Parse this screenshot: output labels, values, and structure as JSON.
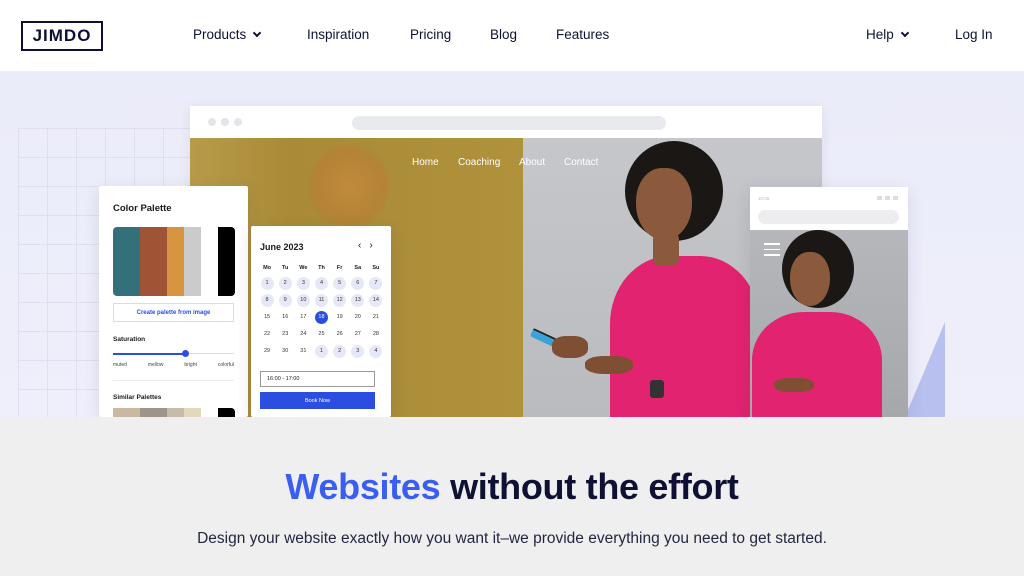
{
  "nav": {
    "logo": "JIMDO",
    "items": [
      {
        "label": "Products",
        "has_dropdown": true
      },
      {
        "label": "Inspiration",
        "has_dropdown": false
      },
      {
        "label": "Pricing",
        "has_dropdown": false
      },
      {
        "label": "Blog",
        "has_dropdown": false
      },
      {
        "label": "Features",
        "has_dropdown": false
      }
    ],
    "help": {
      "label": "Help",
      "has_dropdown": true
    },
    "login": "Log In"
  },
  "hero": {
    "browser_site_nav": [
      "Home",
      "Coaching",
      "About",
      "Contact"
    ],
    "palette_card": {
      "title": "Color Palette",
      "swatches": [
        "#33707a",
        "#a05436",
        "#d89540",
        "#cbcbcb",
        "#ffffff",
        "#000000"
      ],
      "button": "Create palette from image",
      "saturation_label": "Saturation",
      "saturation_options": [
        "muted",
        "mellow",
        "bright",
        "colorful"
      ],
      "saturation_value": 0.6,
      "similar_title": "Similar Palettes",
      "similar_swatches": [
        "#c9b9a0",
        "#9d958c",
        "#c7bca9",
        "#e3d7bd",
        "#ffffff",
        "#000000"
      ]
    },
    "calendar_card": {
      "month": "June 2023",
      "prev_icon": "chevron-left-icon",
      "next_icon": "chevron-right-icon",
      "weekdays": [
        "Mo",
        "Tu",
        "We",
        "Th",
        "Fr",
        "Sa",
        "Su"
      ],
      "days": [
        {
          "d": "1",
          "s": "avail"
        },
        {
          "d": "2",
          "s": "avail"
        },
        {
          "d": "3",
          "s": "avail"
        },
        {
          "d": "4",
          "s": "avail"
        },
        {
          "d": "5",
          "s": "avail"
        },
        {
          "d": "6",
          "s": "avail"
        },
        {
          "d": "7",
          "s": "avail"
        },
        {
          "d": "8",
          "s": "avail"
        },
        {
          "d": "9",
          "s": "avail"
        },
        {
          "d": "10",
          "s": "avail"
        },
        {
          "d": "11",
          "s": "avail"
        },
        {
          "d": "12",
          "s": "avail"
        },
        {
          "d": "13",
          "s": "avail"
        },
        {
          "d": "14",
          "s": "avail"
        },
        {
          "d": "15",
          "s": ""
        },
        {
          "d": "16",
          "s": ""
        },
        {
          "d": "17",
          "s": ""
        },
        {
          "d": "18",
          "s": "sel"
        },
        {
          "d": "19",
          "s": ""
        },
        {
          "d": "20",
          "s": ""
        },
        {
          "d": "21",
          "s": ""
        },
        {
          "d": "22",
          "s": ""
        },
        {
          "d": "23",
          "s": ""
        },
        {
          "d": "24",
          "s": ""
        },
        {
          "d": "25",
          "s": ""
        },
        {
          "d": "26",
          "s": ""
        },
        {
          "d": "27",
          "s": ""
        },
        {
          "d": "28",
          "s": ""
        },
        {
          "d": "29",
          "s": ""
        },
        {
          "d": "30",
          "s": ""
        },
        {
          "d": "31",
          "s": ""
        },
        {
          "d": "1",
          "s": "avail"
        },
        {
          "d": "2",
          "s": "avail"
        },
        {
          "d": "3",
          "s": "avail"
        },
        {
          "d": "4",
          "s": "avail"
        }
      ],
      "time_value": "16:00 - 17:00",
      "book_button": "Book Now"
    },
    "mobile": {
      "time": "10:05"
    }
  },
  "headline": {
    "accent": "Websites",
    "rest": " without the effort"
  },
  "subline": "Design your website exactly how you want it–we provide everything you need to get started."
}
